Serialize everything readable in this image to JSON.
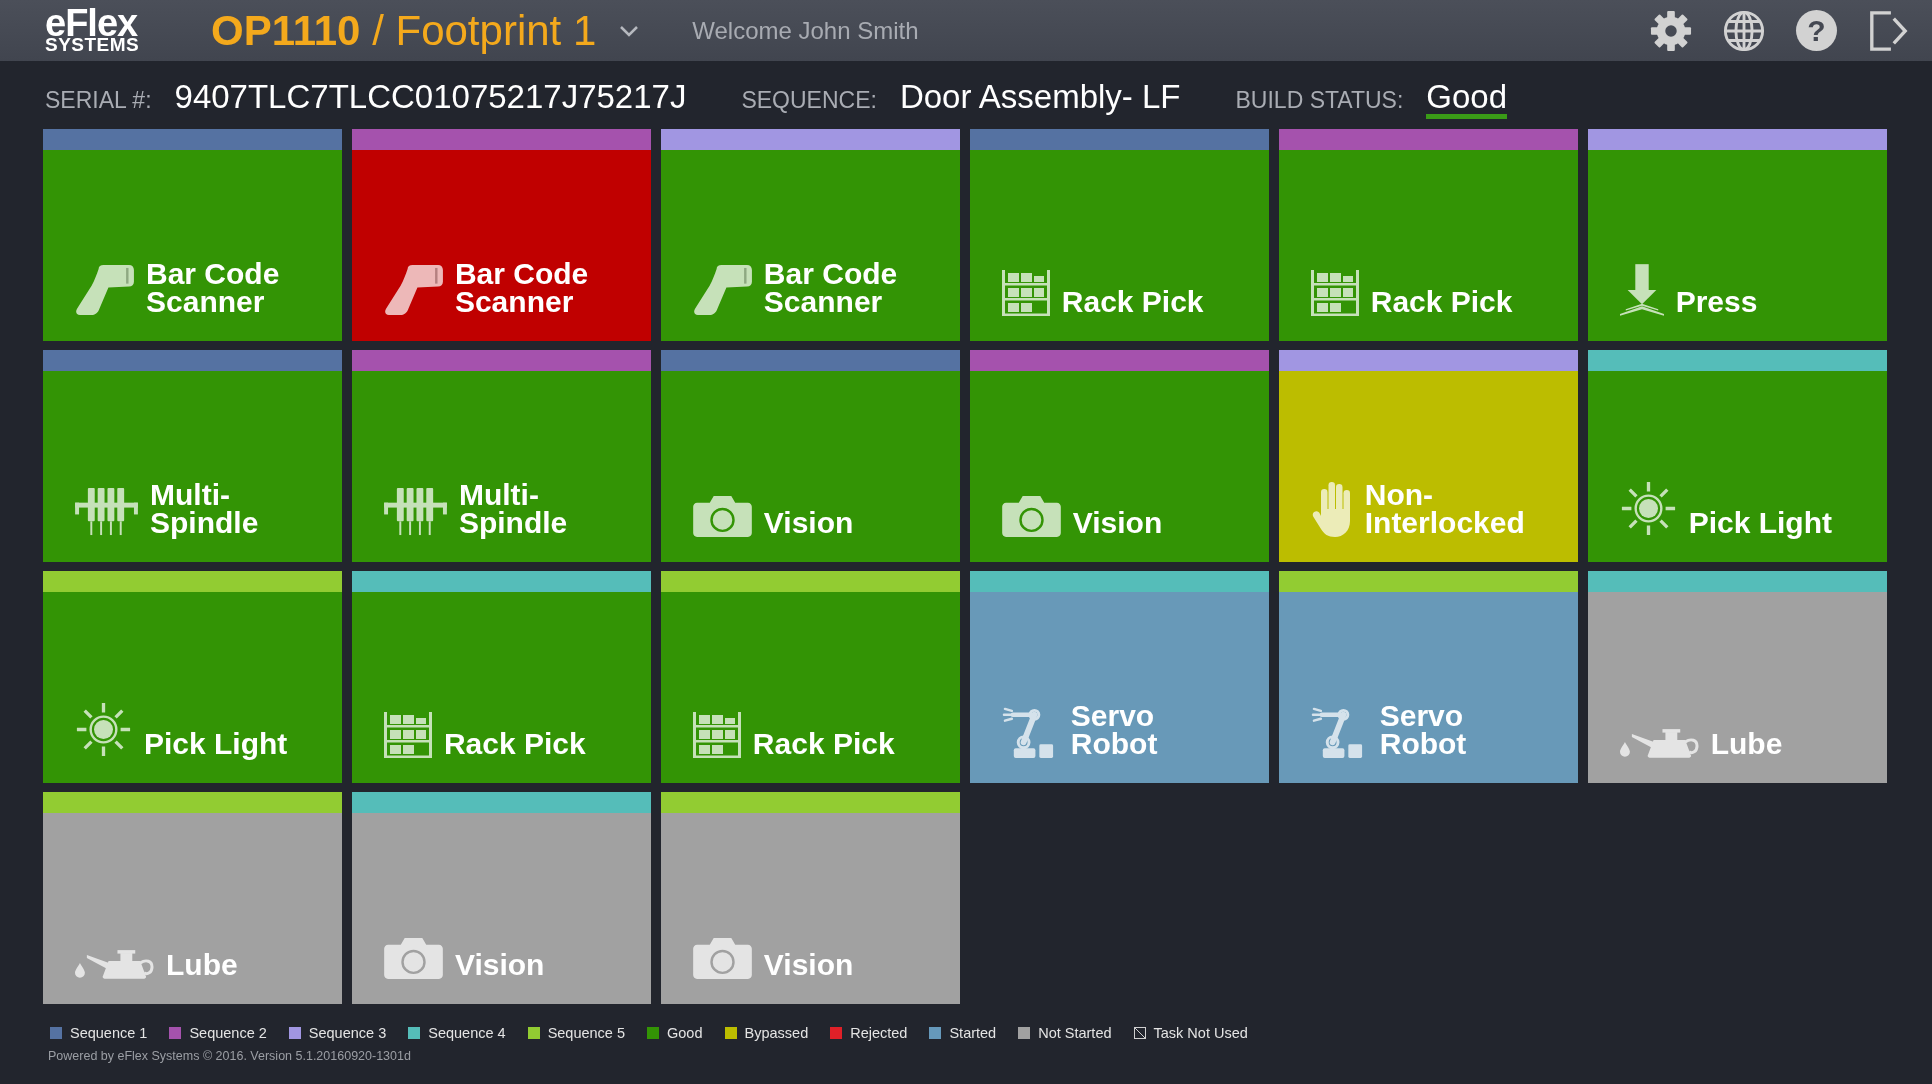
{
  "header": {
    "logo": {
      "name": "eFlex",
      "subtitle": "SYSTEMS"
    },
    "station": "**OP1110** / Footprint 1",
    "welcome": "Welcome John Smith",
    "help": "?"
  },
  "info": [
    {
      "label": "SERIAL #:",
      "value": "9407TLC7TLCC01075217J75217J"
    },
    {
      "label": "SEQUENCE:",
      "value": "Door Assembly- LF"
    },
    {
      "label": "BUILD STATUS:",
      "value": "Good",
      "color": "#3a9b17"
    }
  ],
  "tiles": [
    {
      "kind": "scanner",
      "label": "Bar Code Scanner",
      "color": "#339405",
      "stripe": {
        "color": "#5572a2"
      }
    },
    {
      "kind": "scanner",
      "label": "Bar Code Scanner",
      "color": "#c00000",
      "stripe": {
        "color": "#a552ad"
      }
    },
    {
      "kind": "scanner",
      "label": "Bar Code Scanner",
      "color": "#339405",
      "stripe": {
        "color": "#a196e2"
      }
    },
    {
      "kind": "rack",
      "label": "Rack Pick",
      "color": "#339405",
      "stripe": {
        "color": "#5572a2"
      }
    },
    {
      "kind": "rack",
      "label": "Rack Pick",
      "color": "#339405",
      "stripe": {
        "color": "#a552ad"
      }
    },
    {
      "kind": "press",
      "label": "Press",
      "color": "#339405",
      "stripe": {
        "color": "#a196e2"
      }
    },
    {
      "kind": "spindle",
      "label": "Multi-Spindle",
      "color": "#339405",
      "stripe": {
        "color": "#5572a2"
      }
    },
    {
      "kind": "spindle",
      "label": "Multi-Spindle",
      "color": "#339405",
      "stripe": {
        "color": "#a552ad"
      }
    },
    {
      "kind": "camera",
      "label": "Vision",
      "color": "#339405",
      "stripe": {
        "color": "#5572a2"
      }
    },
    {
      "kind": "camera",
      "label": "Vision",
      "color": "#339405",
      "stripe": {
        "color": "#a552ad"
      }
    },
    {
      "kind": "hand",
      "label": "Non-Interlocked",
      "color": "#bcbd00",
      "stripe": {
        "color": "#a196e2"
      }
    },
    {
      "kind": "light",
      "label": "Pick Light",
      "color": "#339405",
      "stripe": {
        "color": "#55bdb9"
      }
    },
    {
      "kind": "light",
      "label": "Pick Light",
      "color": "#339405",
      "stripe": {
        "color": "#92cc32"
      }
    },
    {
      "kind": "rack",
      "label": "Rack Pick",
      "color": "#339405",
      "stripe": {
        "color": "#55bdb9"
      }
    },
    {
      "kind": "rack",
      "label": "Rack Pick",
      "color": "#339405",
      "stripe": {
        "color": "#92cc32"
      }
    },
    {
      "kind": "robot",
      "label": "Servo Robot",
      "color": "#6899b8",
      "stripe": {
        "color": "#55bdb9"
      }
    },
    {
      "kind": "robot",
      "label": "Servo Robot",
      "color": "#6899b8",
      "stripe": {
        "color": "#92cc32"
      }
    },
    {
      "kind": "lube",
      "label": "Lube",
      "color": "#a1a1a1",
      "stripe": {
        "color": "#55bdb9"
      }
    },
    {
      "kind": "lube",
      "label": "Lube",
      "color": "#a1a1a1",
      "stripe": {
        "color": "#92cc32"
      }
    },
    {
      "kind": "camera",
      "label": "Vision",
      "color": "#a1a1a1",
      "stripe": {
        "color": "#55bdb9"
      }
    },
    {
      "kind": "camera",
      "label": "Vision",
      "color": "#a1a1a1",
      "stripe": {
        "color": "#92cc32"
      }
    }
  ],
  "legend": [
    {
      "kind": "swatch",
      "label": "Sequence 1",
      "color": "#5572a2"
    },
    {
      "kind": "swatch",
      "label": "Sequence 2",
      "color": "#a552ad"
    },
    {
      "kind": "swatch",
      "label": "Sequence 3",
      "color": "#a196e2"
    },
    {
      "kind": "swatch",
      "label": "Sequence 4",
      "color": "#55bdb9"
    },
    {
      "kind": "swatch",
      "label": "Sequence 5",
      "color": "#92cc32"
    },
    {
      "kind": "swatch",
      "label": "Good",
      "color": "#339405"
    },
    {
      "kind": "swatch",
      "label": "Bypassed",
      "color": "#bcbd00"
    },
    {
      "kind": "swatch",
      "label": "Rejected",
      "color": "#e02028"
    },
    {
      "kind": "swatch",
      "label": "Started",
      "color": "#6699bb"
    },
    {
      "kind": "swatch",
      "label": "Not Started",
      "color": "#a1a1a1"
    },
    {
      "kind": "unused",
      "label": "Task Not Used"
    }
  ],
  "footer": "Powered by eFlex Systems © 2016. Version 5.1.20160920-1301d"
}
